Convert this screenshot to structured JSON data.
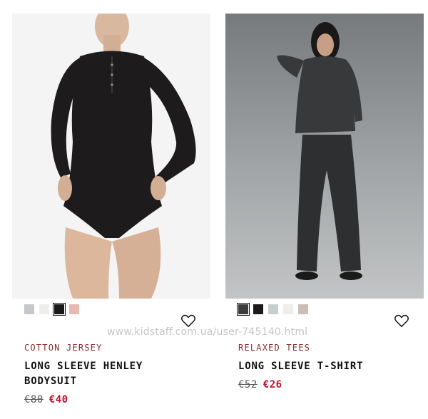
{
  "watermark": "www.kidstaff.com.ua/user-745140.html",
  "products": [
    {
      "collection": "COTTON JERSEY",
      "name_line1": "LONG SLEEVE HENLEY",
      "name_line2": "BODYSUIT",
      "old_price": "€80",
      "new_price": "€40",
      "image_alt": "Model wearing black long sleeve henley bodysuit",
      "swatches": [
        {
          "name": "grey",
          "color": "#c6c9cb",
          "selected": false
        },
        {
          "name": "white",
          "color": "#efeeea",
          "selected": false
        },
        {
          "name": "black",
          "color": "#1a1a1a",
          "selected": true
        },
        {
          "name": "pink",
          "color": "#e7b9b3",
          "selected": false
        }
      ],
      "favorite_icon": "heart-icon"
    },
    {
      "collection": "RELAXED TEES",
      "name_line1": "LONG SLEEVE T-SHIRT",
      "name_line2": "",
      "old_price": "€52",
      "new_price": "€26",
      "image_alt": "Model wearing dark grey long sleeve t-shirt and ribbed pants",
      "swatches": [
        {
          "name": "charcoal",
          "color": "#3d3d3f",
          "selected": true
        },
        {
          "name": "black",
          "color": "#1b1b1b",
          "selected": false
        },
        {
          "name": "light-blue-grey",
          "color": "#c5cfd2",
          "selected": false
        },
        {
          "name": "white",
          "color": "#efeeea",
          "selected": false
        },
        {
          "name": "taupe",
          "color": "#c9bfb6",
          "selected": false
        }
      ],
      "favorite_icon": "heart-icon"
    }
  ],
  "colors": {
    "collection_text": "#8a2b2b",
    "sale_price": "#c8102e"
  }
}
